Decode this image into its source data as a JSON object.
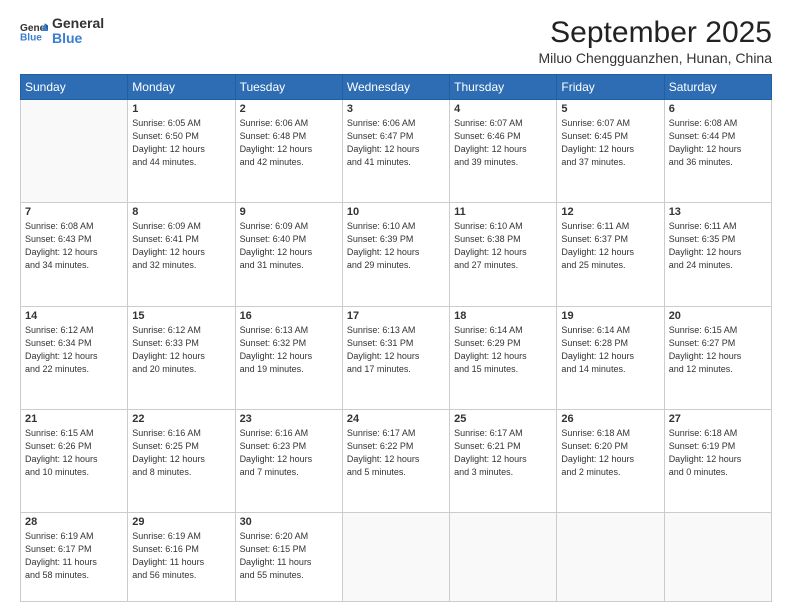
{
  "logo": {
    "general": "General",
    "blue": "Blue"
  },
  "header": {
    "month_year": "September 2025",
    "location": "Miluo Chengguanzhen, Hunan, China"
  },
  "weekdays": [
    "Sunday",
    "Monday",
    "Tuesday",
    "Wednesday",
    "Thursday",
    "Friday",
    "Saturday"
  ],
  "weeks": [
    [
      {
        "day": "",
        "info": ""
      },
      {
        "day": "1",
        "info": "Sunrise: 6:05 AM\nSunset: 6:50 PM\nDaylight: 12 hours\nand 44 minutes."
      },
      {
        "day": "2",
        "info": "Sunrise: 6:06 AM\nSunset: 6:48 PM\nDaylight: 12 hours\nand 42 minutes."
      },
      {
        "day": "3",
        "info": "Sunrise: 6:06 AM\nSunset: 6:47 PM\nDaylight: 12 hours\nand 41 minutes."
      },
      {
        "day": "4",
        "info": "Sunrise: 6:07 AM\nSunset: 6:46 PM\nDaylight: 12 hours\nand 39 minutes."
      },
      {
        "day": "5",
        "info": "Sunrise: 6:07 AM\nSunset: 6:45 PM\nDaylight: 12 hours\nand 37 minutes."
      },
      {
        "day": "6",
        "info": "Sunrise: 6:08 AM\nSunset: 6:44 PM\nDaylight: 12 hours\nand 36 minutes."
      }
    ],
    [
      {
        "day": "7",
        "info": "Sunrise: 6:08 AM\nSunset: 6:43 PM\nDaylight: 12 hours\nand 34 minutes."
      },
      {
        "day": "8",
        "info": "Sunrise: 6:09 AM\nSunset: 6:41 PM\nDaylight: 12 hours\nand 32 minutes."
      },
      {
        "day": "9",
        "info": "Sunrise: 6:09 AM\nSunset: 6:40 PM\nDaylight: 12 hours\nand 31 minutes."
      },
      {
        "day": "10",
        "info": "Sunrise: 6:10 AM\nSunset: 6:39 PM\nDaylight: 12 hours\nand 29 minutes."
      },
      {
        "day": "11",
        "info": "Sunrise: 6:10 AM\nSunset: 6:38 PM\nDaylight: 12 hours\nand 27 minutes."
      },
      {
        "day": "12",
        "info": "Sunrise: 6:11 AM\nSunset: 6:37 PM\nDaylight: 12 hours\nand 25 minutes."
      },
      {
        "day": "13",
        "info": "Sunrise: 6:11 AM\nSunset: 6:35 PM\nDaylight: 12 hours\nand 24 minutes."
      }
    ],
    [
      {
        "day": "14",
        "info": "Sunrise: 6:12 AM\nSunset: 6:34 PM\nDaylight: 12 hours\nand 22 minutes."
      },
      {
        "day": "15",
        "info": "Sunrise: 6:12 AM\nSunset: 6:33 PM\nDaylight: 12 hours\nand 20 minutes."
      },
      {
        "day": "16",
        "info": "Sunrise: 6:13 AM\nSunset: 6:32 PM\nDaylight: 12 hours\nand 19 minutes."
      },
      {
        "day": "17",
        "info": "Sunrise: 6:13 AM\nSunset: 6:31 PM\nDaylight: 12 hours\nand 17 minutes."
      },
      {
        "day": "18",
        "info": "Sunrise: 6:14 AM\nSunset: 6:29 PM\nDaylight: 12 hours\nand 15 minutes."
      },
      {
        "day": "19",
        "info": "Sunrise: 6:14 AM\nSunset: 6:28 PM\nDaylight: 12 hours\nand 14 minutes."
      },
      {
        "day": "20",
        "info": "Sunrise: 6:15 AM\nSunset: 6:27 PM\nDaylight: 12 hours\nand 12 minutes."
      }
    ],
    [
      {
        "day": "21",
        "info": "Sunrise: 6:15 AM\nSunset: 6:26 PM\nDaylight: 12 hours\nand 10 minutes."
      },
      {
        "day": "22",
        "info": "Sunrise: 6:16 AM\nSunset: 6:25 PM\nDaylight: 12 hours\nand 8 minutes."
      },
      {
        "day": "23",
        "info": "Sunrise: 6:16 AM\nSunset: 6:23 PM\nDaylight: 12 hours\nand 7 minutes."
      },
      {
        "day": "24",
        "info": "Sunrise: 6:17 AM\nSunset: 6:22 PM\nDaylight: 12 hours\nand 5 minutes."
      },
      {
        "day": "25",
        "info": "Sunrise: 6:17 AM\nSunset: 6:21 PM\nDaylight: 12 hours\nand 3 minutes."
      },
      {
        "day": "26",
        "info": "Sunrise: 6:18 AM\nSunset: 6:20 PM\nDaylight: 12 hours\nand 2 minutes."
      },
      {
        "day": "27",
        "info": "Sunrise: 6:18 AM\nSunset: 6:19 PM\nDaylight: 12 hours\nand 0 minutes."
      }
    ],
    [
      {
        "day": "28",
        "info": "Sunrise: 6:19 AM\nSunset: 6:17 PM\nDaylight: 11 hours\nand 58 minutes."
      },
      {
        "day": "29",
        "info": "Sunrise: 6:19 AM\nSunset: 6:16 PM\nDaylight: 11 hours\nand 56 minutes."
      },
      {
        "day": "30",
        "info": "Sunrise: 6:20 AM\nSunset: 6:15 PM\nDaylight: 11 hours\nand 55 minutes."
      },
      {
        "day": "",
        "info": ""
      },
      {
        "day": "",
        "info": ""
      },
      {
        "day": "",
        "info": ""
      },
      {
        "day": "",
        "info": ""
      }
    ]
  ]
}
